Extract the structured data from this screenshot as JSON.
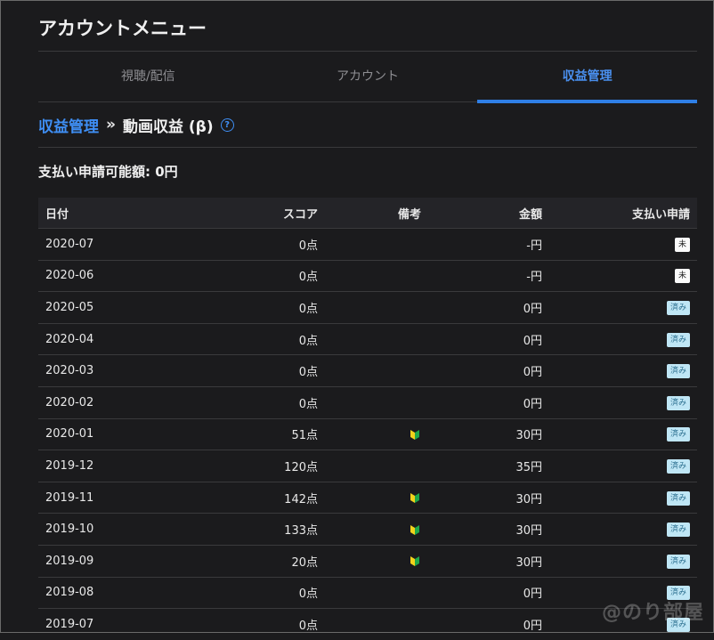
{
  "menu_title": "アカウントメニュー",
  "tabs": [
    {
      "label": "視聴/配信",
      "active": false
    },
    {
      "label": "アカウント",
      "active": false
    },
    {
      "label": "収益管理",
      "active": true
    }
  ],
  "breadcrumb": {
    "parent": "収益管理",
    "separator": "»",
    "current": "動画収益 (β)",
    "help_icon": "?"
  },
  "payable_label": "支払い申請可能額: 0円",
  "table": {
    "headers": {
      "date": "日付",
      "score": "スコア",
      "note": "備考",
      "amount": "金額",
      "status": "支払い申請"
    },
    "rows": [
      {
        "date": "2020-07",
        "score": "0点",
        "beginner": false,
        "amount": "-円",
        "status": "未",
        "paid": false
      },
      {
        "date": "2020-06",
        "score": "0点",
        "beginner": false,
        "amount": "-円",
        "status": "未",
        "paid": false
      },
      {
        "date": "2020-05",
        "score": "0点",
        "beginner": false,
        "amount": "0円",
        "status": "済み",
        "paid": true
      },
      {
        "date": "2020-04",
        "score": "0点",
        "beginner": false,
        "amount": "0円",
        "status": "済み",
        "paid": true
      },
      {
        "date": "2020-03",
        "score": "0点",
        "beginner": false,
        "amount": "0円",
        "status": "済み",
        "paid": true
      },
      {
        "date": "2020-02",
        "score": "0点",
        "beginner": false,
        "amount": "0円",
        "status": "済み",
        "paid": true
      },
      {
        "date": "2020-01",
        "score": "51点",
        "beginner": true,
        "amount": "30円",
        "status": "済み",
        "paid": true
      },
      {
        "date": "2019-12",
        "score": "120点",
        "beginner": false,
        "amount": "35円",
        "status": "済み",
        "paid": true
      },
      {
        "date": "2019-11",
        "score": "142点",
        "beginner": true,
        "amount": "30円",
        "status": "済み",
        "paid": true
      },
      {
        "date": "2019-10",
        "score": "133点",
        "beginner": true,
        "amount": "30円",
        "status": "済み",
        "paid": true
      },
      {
        "date": "2019-09",
        "score": "20点",
        "beginner": true,
        "amount": "30円",
        "status": "済み",
        "paid": true
      },
      {
        "date": "2019-08",
        "score": "0点",
        "beginner": false,
        "amount": "0円",
        "status": "済み",
        "paid": true
      },
      {
        "date": "2019-07",
        "score": "0点",
        "beginner": false,
        "amount": "0円",
        "status": "済み",
        "paid": true
      }
    ]
  },
  "watermark": "@のり部屋",
  "colors": {
    "background": "#1b1b1d",
    "accent": "#2f7fe6",
    "paid_badge": "#bfe6f5",
    "unpaid_badge": "#fafafa"
  }
}
